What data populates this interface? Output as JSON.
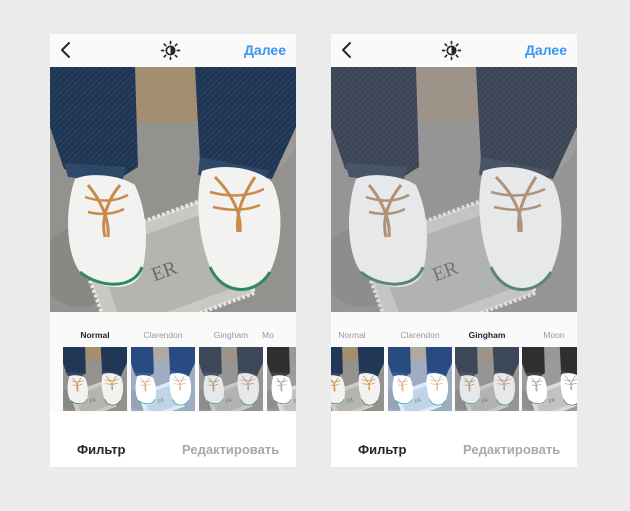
{
  "screens": [
    {
      "header": {
        "back_icon": "chevron-left-icon",
        "brightness_icon": "brightness-icon",
        "next_label": "Далее"
      },
      "photo": {
        "filter": "Normal"
      },
      "filters": [
        {
          "label": "Normal",
          "active": true,
          "tone": "normal"
        },
        {
          "label": "Clarendon",
          "active": false,
          "tone": "clarendon"
        },
        {
          "label": "Gingham",
          "active": false,
          "tone": "gingham"
        },
        {
          "label": "Moon",
          "active": false,
          "tone": "moon"
        }
      ],
      "tabs": {
        "filter": "Фильтр",
        "edit": "Редактировать"
      }
    },
    {
      "header": {
        "back_icon": "chevron-left-icon",
        "brightness_icon": "brightness-icon",
        "next_label": "Далее"
      },
      "photo": {
        "filter": "Gingham"
      },
      "filters": [
        {
          "label": "Normal",
          "active": false,
          "tone": "normal"
        },
        {
          "label": "Clarendon",
          "active": false,
          "tone": "clarendon"
        },
        {
          "label": "Gingham",
          "active": true,
          "tone": "gingham"
        },
        {
          "label": "Moon",
          "active": false,
          "tone": "moon"
        }
      ],
      "tabs": {
        "filter": "Фильтр",
        "edit": "Редактировать"
      }
    }
  ],
  "colors": {
    "accent": "#3897f0",
    "background": "#ebebeb"
  }
}
